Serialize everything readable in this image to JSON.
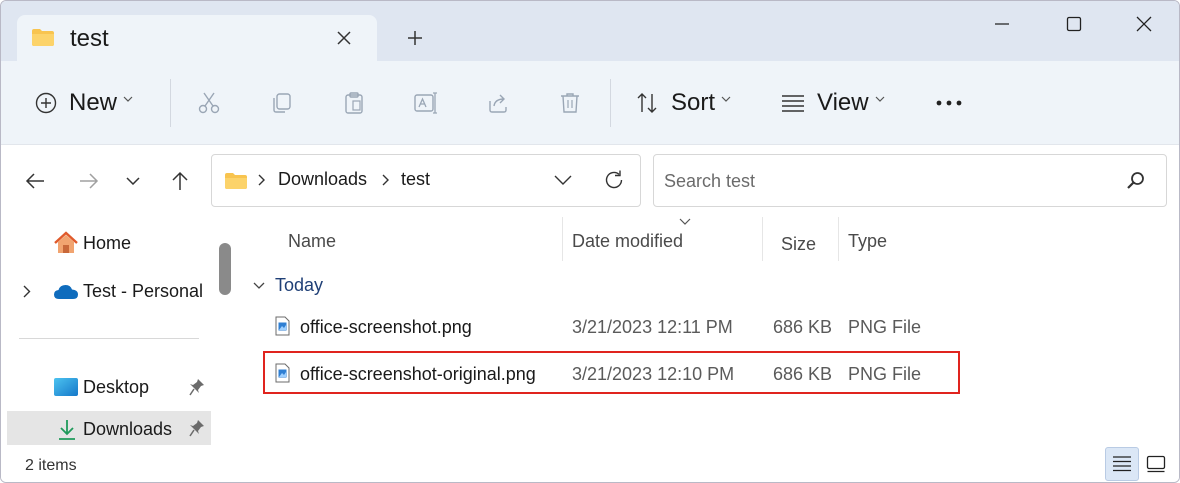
{
  "window": {
    "tab_title": "test",
    "colors": {
      "titlebar": "#dfe6f1",
      "toolbar": "#eff4f9",
      "folder": "#f8c44f",
      "highlight_border": "#e0241e",
      "accent": "#0067c0"
    }
  },
  "toolbar": {
    "new_label": "New",
    "sort_label": "Sort",
    "view_label": "View",
    "icons": [
      "cut-icon",
      "copy-icon",
      "paste-icon",
      "rename-icon",
      "share-icon",
      "delete-icon",
      "more-icon"
    ]
  },
  "address": {
    "crumbs": [
      "Downloads",
      "test"
    ],
    "search_placeholder": "Search test"
  },
  "sidebar": {
    "items": [
      {
        "label": "Home",
        "icon": "home-icon"
      },
      {
        "label": "Test - Personal",
        "icon": "onedrive-cloud-icon"
      },
      {
        "label": "Desktop",
        "icon": "desktop-icon",
        "pinned": true
      },
      {
        "label": "Downloads",
        "icon": "download-icon",
        "pinned": true,
        "selected": true
      }
    ]
  },
  "files": {
    "columns": [
      "Name",
      "Date modified",
      "Size",
      "Type"
    ],
    "sorted_column": "Date modified",
    "group_label": "Today",
    "rows": [
      {
        "name": "office-screenshot.png",
        "date": "3/21/2023 12:11 PM",
        "size": "686 KB",
        "type": "PNG File",
        "highlighted": false
      },
      {
        "name": "office-screenshot-original.png",
        "date": "3/21/2023 12:10 PM",
        "size": "686 KB",
        "type": "PNG File",
        "highlighted": true
      }
    ]
  },
  "status": {
    "item_count": "2 items",
    "active_view": "details"
  }
}
